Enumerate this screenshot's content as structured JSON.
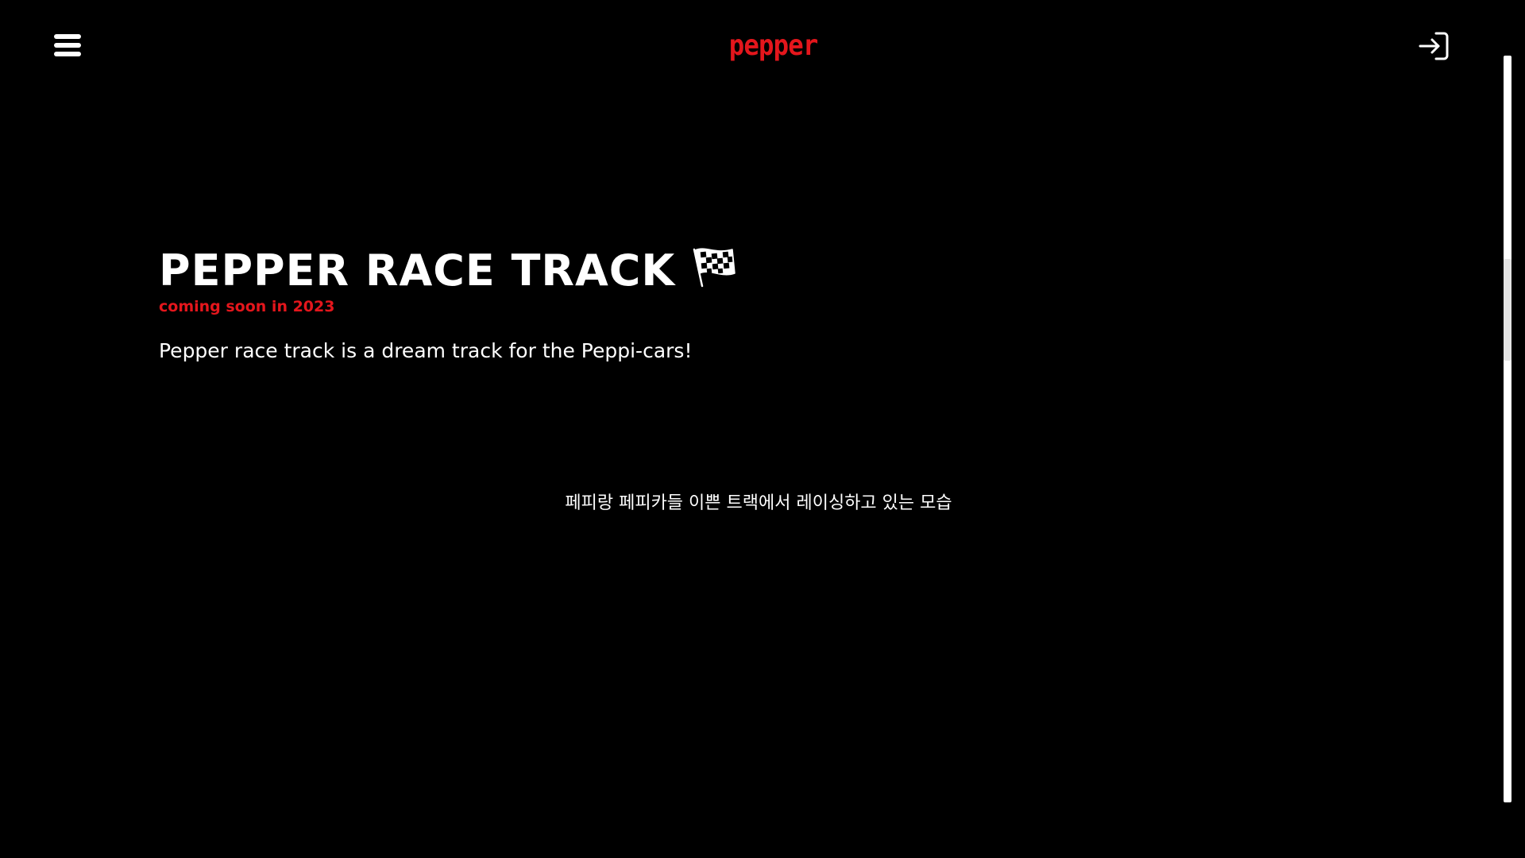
{
  "header": {
    "logo_text": "pepper",
    "menu_icon": "hamburger-menu-icon",
    "login_icon": "login-arrow-icon",
    "accent_color": "#e4161c"
  },
  "hero": {
    "title": "PEPPER RACE TRACK",
    "title_icon": "checkered-flag-icon",
    "subtitle": "coming soon in 2023",
    "description": "Pepper race track is a dream track for the Peppi-cars!"
  },
  "caption": {
    "text": "페피랑 페피카들 이쁜 트랙에서 레이싱하고 있는 모습"
  }
}
